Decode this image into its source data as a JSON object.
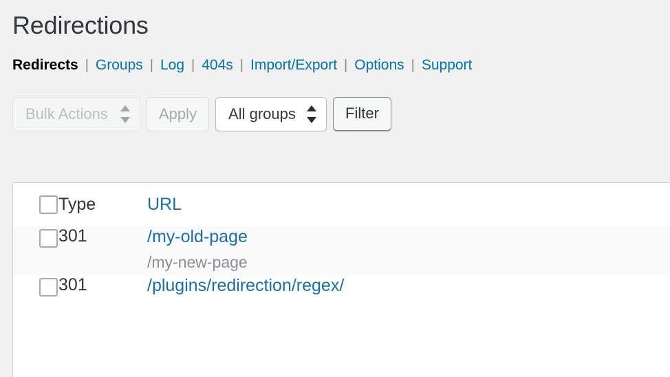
{
  "page": {
    "title": "Redirections"
  },
  "nav": {
    "separator": "|",
    "items": [
      {
        "label": "Redirects",
        "current": true
      },
      {
        "label": "Groups",
        "current": false
      },
      {
        "label": "Log",
        "current": false
      },
      {
        "label": "404s",
        "current": false
      },
      {
        "label": "Import/Export",
        "current": false
      },
      {
        "label": "Options",
        "current": false
      },
      {
        "label": "Support",
        "current": false
      }
    ]
  },
  "toolbar": {
    "bulk_actions": {
      "selected": "Bulk Actions",
      "disabled": true,
      "options": [
        "Bulk Actions"
      ]
    },
    "apply_label": "Apply",
    "apply_disabled": true,
    "group_filter": {
      "selected": "All groups",
      "disabled": false,
      "options": [
        "All groups"
      ]
    },
    "filter_label": "Filter"
  },
  "table": {
    "columns": {
      "checkbox": "",
      "type": "Type",
      "url": "URL"
    },
    "rows": [
      {
        "type": "301",
        "url": "/my-old-page",
        "target": "/my-new-page"
      },
      {
        "type": "301",
        "url": "/plugins/redirection/regex/",
        "target": ""
      }
    ]
  },
  "colors": {
    "link": "#0073aa",
    "link_table": "#1d6ea3",
    "text": "#32373c",
    "muted": "#8c8f94",
    "page_bg": "#f1f1f1",
    "row_alt_bg": "#f9f9f9",
    "border": "#ccd0d4"
  }
}
